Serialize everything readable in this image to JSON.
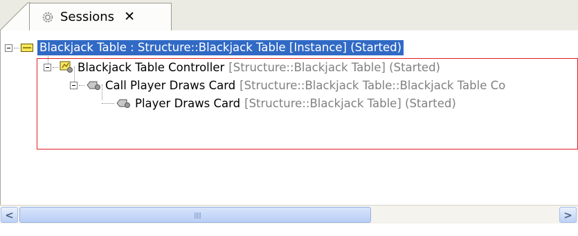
{
  "tab": {
    "label": "Sessions",
    "close": "✕"
  },
  "tree": {
    "root": {
      "name": "Blackjack Table : Structure::Blackjack Table [Instance] (Started)"
    },
    "controller": {
      "name": "Blackjack Table Controller",
      "meta": "[Structure::Blackjack Table] (Started)"
    },
    "call": {
      "name": "Call Player Draws Card",
      "meta": "[Structure::Blackjack Table::Blackjack Table Co"
    },
    "player": {
      "name": "Player Draws Card",
      "meta": "[Structure::Blackjack Table] (Started)"
    }
  },
  "scrollbar": {
    "left": "<",
    "right": ">"
  },
  "colors": {
    "selection": "#316ac5",
    "highlight_border": "#e21c25"
  }
}
